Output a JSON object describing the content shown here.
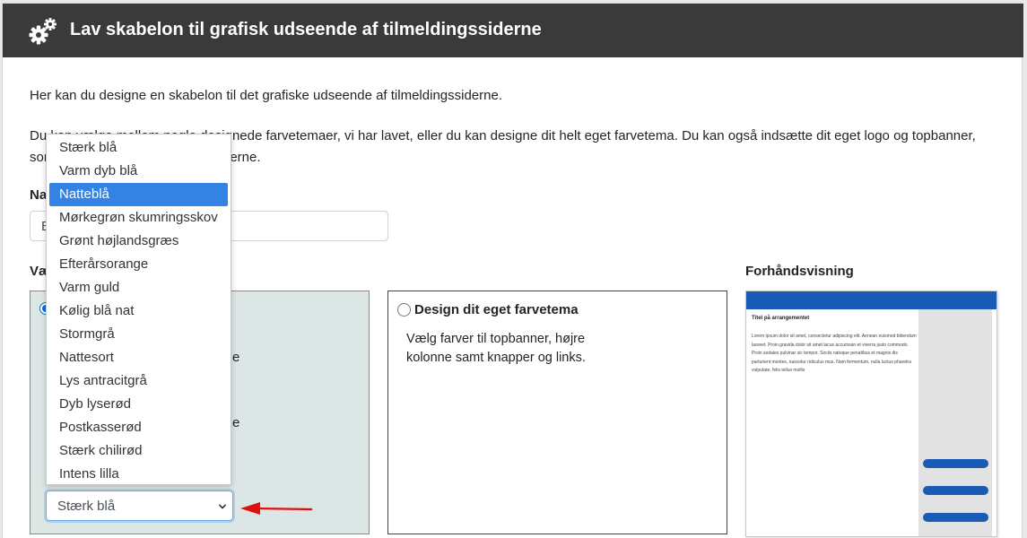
{
  "header": {
    "title": "Lav skabelon til grafisk udseende af tilmeldingssiderne",
    "icon": "gears-icon"
  },
  "intro": {
    "line1": "Her kan du designe en skabelon til det grafiske udseende af tilmeldingssiderne.",
    "line2_visible_start": "Du kan vælge mellem nogle designede farvetemaer, vi har lavet, eller du kan designe dit helt eget farvetema. Du kan også indsætte dit eget logo og topbanner,",
    "line2_visible_end_prefix": "som",
    "line2_visible_end_suffix": "erne.",
    "line2_partial_mid": "nede farvetemaer, vi har lavet, eller du kan designe dit helt eget farvetema. Du kan også indsætte dit eget logo og topbanner,",
    "line2_start_left": "Du kan vælge mellem nogle desig"
  },
  "form": {
    "name_label_fragment": "Na",
    "name_input_fragment": "B",
    "choose_label_fragment": "Væ",
    "box1_fragments": [
      "e",
      "e"
    ]
  },
  "theme_select": {
    "selected_value": "Stærk blå",
    "highlighted": "Natteblå",
    "options": [
      "Stærk blå",
      "Varm dyb blå",
      "Natteblå",
      "Mørkegrøn skumringsskov",
      "Grønt højlandsgræs",
      "Efterårsorange",
      "Varm guld",
      "Kølig blå nat",
      "Stormgrå",
      "Nattesort",
      "Lys antracitgrå",
      "Dyb lyserød",
      "Postkasserød",
      "Stærk chilirød",
      "Intens lilla"
    ]
  },
  "custom_theme": {
    "label": "Design dit eget farvetema",
    "description": "Vælg farver til topbanner, højre kolonne samt knapper og links."
  },
  "preview": {
    "label": "Forhåndsvisning",
    "event_title": "Titel på arrangementet",
    "body_text": "Lorem ipsum dolor sit amet, consectetur adipiscing elit. Aenean euismod bibendum laoreet. Proin gravida dolor sit amet lacus accumsan et viverra justo commodo. Proin sodales pulvinar sic tempor. Sociis natoque penatibus et magnis dis parturient montes, nascetur ridiculus mus. Nam fermentum, nulla luctus pharetra vulputate, felis tellus mollis",
    "accent_color": "#1a5bb5",
    "sidebar_color": "#e2e2e2"
  },
  "colors": {
    "header_bg": "#3a3a3a",
    "box1_bg": "#dce6e5",
    "highlight": "#3582e5",
    "arrow": "#e01010"
  }
}
